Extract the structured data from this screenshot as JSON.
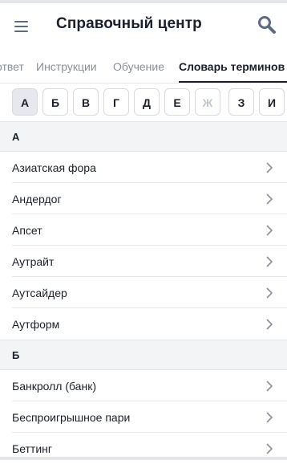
{
  "header": {
    "title": "Справочный центр",
    "menu_icon": "hamburger-menu-icon",
    "search_icon": "search-icon"
  },
  "tabs": [
    {
      "label": "ответ",
      "active": false
    },
    {
      "label": "Инструкции",
      "active": false
    },
    {
      "label": "Обучение",
      "active": false
    },
    {
      "label": "Словарь терминов",
      "active": true
    }
  ],
  "alphabet": [
    {
      "letter": "А",
      "state": "active"
    },
    {
      "letter": "Б",
      "state": "normal"
    },
    {
      "letter": "В",
      "state": "normal"
    },
    {
      "letter": "Г",
      "state": "normal"
    },
    {
      "letter": "Д",
      "state": "normal"
    },
    {
      "letter": "Е",
      "state": "normal"
    },
    {
      "letter": "Ж",
      "state": "disabled"
    },
    {
      "letter": "З",
      "state": "normal"
    },
    {
      "letter": "И",
      "state": "normal"
    }
  ],
  "sections": [
    {
      "letter": "А",
      "terms": [
        "Азиатская фора",
        "Андердог",
        "Апсет",
        "Аутрайт",
        "Аутсайдер",
        "Аутформ"
      ]
    },
    {
      "letter": "Б",
      "terms": [
        "Банкролл (банк)",
        "Беспроигрышное пари",
        "Беттинг"
      ]
    }
  ],
  "colors": {
    "text": "#1c1f2e",
    "muted": "#8a8f9b",
    "section_bg": "#f3f4f6",
    "icon": "#5c6b82"
  }
}
